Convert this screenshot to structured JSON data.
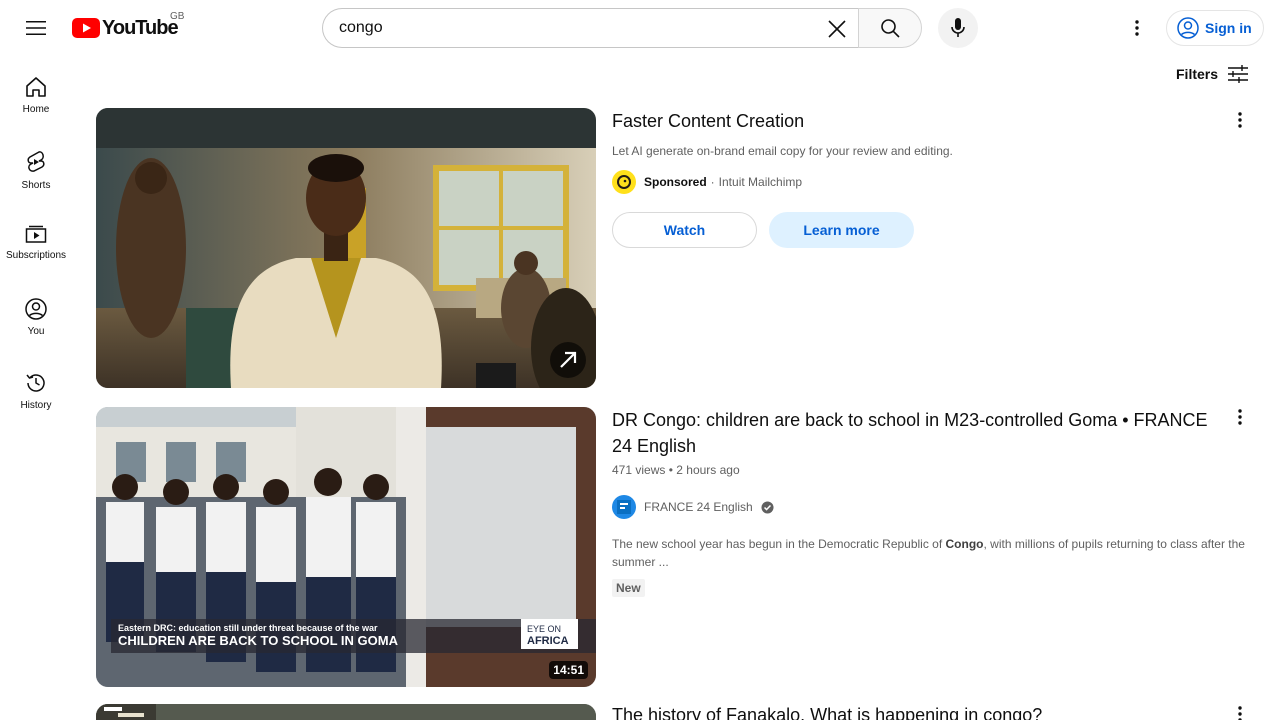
{
  "header": {
    "logo_text": "YouTube",
    "country": "GB",
    "search_value": "congo",
    "search_placeholder": "Search",
    "signin_label": "Sign in"
  },
  "sidebar": {
    "items": [
      {
        "label": "Home",
        "icon": "home-icon"
      },
      {
        "label": "Shorts",
        "icon": "shorts-icon"
      },
      {
        "label": "Subscriptions",
        "icon": "subscriptions-icon"
      },
      {
        "label": "You",
        "icon": "you-icon"
      },
      {
        "label": "History",
        "icon": "history-icon"
      }
    ]
  },
  "filters_label": "Filters",
  "ad": {
    "title": "Faster Content Creation",
    "description": "Let AI generate on-brand email copy for your review and editing.",
    "sponsored_label": "Sponsored",
    "separator": "·",
    "advertiser": "Intuit Mailchimp",
    "watch_label": "Watch",
    "learn_more_label": "Learn more"
  },
  "results": [
    {
      "title": "DR Congo: children are back to school in M23-controlled Goma • FRANCE 24 English",
      "views": "471 views",
      "separator": "•",
      "age": "2 hours ago",
      "channel": "FRANCE 24 English",
      "description_before": "The new school year has begun in the Democratic Republic of ",
      "description_highlight": "Congo",
      "description_after": ", with millions of pupils returning to class after the summer ...",
      "badge": "New",
      "duration": "14:51",
      "thumb_caption_top": "Eastern DRC: education still under threat because of the war",
      "thumb_caption_main": "CHILDREN ARE BACK TO SCHOOL IN GOMA",
      "thumb_brand_1": "EYE ON",
      "thumb_brand_2": "AFRICA"
    },
    {
      "title": "The history of Fanakalo. What is happening in congo?"
    }
  ],
  "colors": {
    "accent_blue": "#065fd4",
    "youtube_red": "#ff0000"
  }
}
